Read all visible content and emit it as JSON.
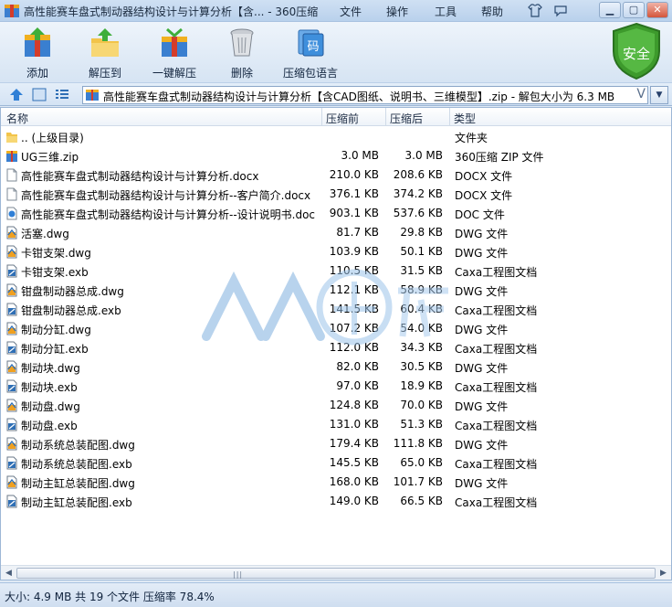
{
  "titlebar": {
    "title": "高性能赛车盘式制动器结构设计与计算分析【含... - 360压缩",
    "menu": [
      "文件",
      "操作",
      "工具",
      "帮助"
    ],
    "window_buttons": [
      "minimize",
      "restore",
      "close"
    ]
  },
  "toolbar": {
    "buttons": [
      {
        "label": "添加",
        "icon": "archive-add-icon"
      },
      {
        "label": "解压到",
        "icon": "extract-folder-icon"
      },
      {
        "label": "一键解压",
        "icon": "one-click-extract-icon"
      },
      {
        "label": "删除",
        "icon": "trash-icon"
      },
      {
        "label": "压缩包语言",
        "icon": "encoding-icon"
      }
    ],
    "encoding_glyph": "码",
    "security_label": "安全"
  },
  "address": {
    "path": "高性能赛车盘式制动器结构设计与计算分析【含CAD图纸、说明书、三维模型】.zip - 解包大小为 6.3 MB"
  },
  "columns": {
    "name": "名称",
    "size": "压缩前",
    "compressed": "压缩后",
    "type": "类型"
  },
  "files": [
    {
      "name": ".. (上级目录)",
      "size": "",
      "compressed": "",
      "type": "文件夹",
      "icon": "folder"
    },
    {
      "name": "UG三维.zip",
      "size": "3.0 MB",
      "compressed": "3.0 MB",
      "type": "360压缩 ZIP 文件",
      "icon": "zip"
    },
    {
      "name": "高性能赛车盘式制动器结构设计与计算分析.docx",
      "size": "210.0 KB",
      "compressed": "208.6 KB",
      "type": "DOCX 文件",
      "icon": "doc"
    },
    {
      "name": "高性能赛车盘式制动器结构设计与计算分析--客户简介.docx",
      "size": "376.1 KB",
      "compressed": "374.2 KB",
      "type": "DOCX 文件",
      "icon": "doc"
    },
    {
      "name": "高性能赛车盘式制动器结构设计与计算分析--设计说明书.doc",
      "size": "903.1 KB",
      "compressed": "537.6 KB",
      "type": "DOC 文件",
      "icon": "docblue"
    },
    {
      "name": "活塞.dwg",
      "size": "81.7 KB",
      "compressed": "29.8 KB",
      "type": "DWG 文件",
      "icon": "dwg"
    },
    {
      "name": "卡钳支架.dwg",
      "size": "103.9 KB",
      "compressed": "50.1 KB",
      "type": "DWG 文件",
      "icon": "dwg"
    },
    {
      "name": "卡钳支架.exb",
      "size": "110.5 KB",
      "compressed": "31.5 KB",
      "type": "Caxa工程图文档",
      "icon": "exb"
    },
    {
      "name": "钳盘制动器总成.dwg",
      "size": "112.1 KB",
      "compressed": "58.9 KB",
      "type": "DWG 文件",
      "icon": "dwg"
    },
    {
      "name": "钳盘制动器总成.exb",
      "size": "141.5 KB",
      "compressed": "60.4 KB",
      "type": "Caxa工程图文档",
      "icon": "exb"
    },
    {
      "name": "制动分缸.dwg",
      "size": "107.2 KB",
      "compressed": "54.0 KB",
      "type": "DWG 文件",
      "icon": "dwg"
    },
    {
      "name": "制动分缸.exb",
      "size": "112.0 KB",
      "compressed": "34.3 KB",
      "type": "Caxa工程图文档",
      "icon": "exb"
    },
    {
      "name": "制动块.dwg",
      "size": "82.0 KB",
      "compressed": "30.5 KB",
      "type": "DWG 文件",
      "icon": "dwg"
    },
    {
      "name": "制动块.exb",
      "size": "97.0 KB",
      "compressed": "18.9 KB",
      "type": "Caxa工程图文档",
      "icon": "exb"
    },
    {
      "name": "制动盘.dwg",
      "size": "124.8 KB",
      "compressed": "70.0 KB",
      "type": "DWG 文件",
      "icon": "dwg"
    },
    {
      "name": "制动盘.exb",
      "size": "131.0 KB",
      "compressed": "51.3 KB",
      "type": "Caxa工程图文档",
      "icon": "exb"
    },
    {
      "name": "制动系统总装配图.dwg",
      "size": "179.4 KB",
      "compressed": "111.8 KB",
      "type": "DWG 文件",
      "icon": "dwg"
    },
    {
      "name": "制动系统总装配图.exb",
      "size": "145.5 KB",
      "compressed": "65.0 KB",
      "type": "Caxa工程图文档",
      "icon": "exb"
    },
    {
      "name": "制动主缸总装配图.dwg",
      "size": "168.0 KB",
      "compressed": "101.7 KB",
      "type": "DWG 文件",
      "icon": "dwg"
    },
    {
      "name": "制动主缸总装配图.exb",
      "size": "149.0 KB",
      "compressed": "66.5 KB",
      "type": "Caxa工程图文档",
      "icon": "exb"
    }
  ],
  "status": {
    "text": "大小: 4.9 MB 共 19 个文件 压缩率 78.4%"
  },
  "colors": {
    "accent": "#1f6fb8",
    "security_green": "#3d9a2c"
  }
}
